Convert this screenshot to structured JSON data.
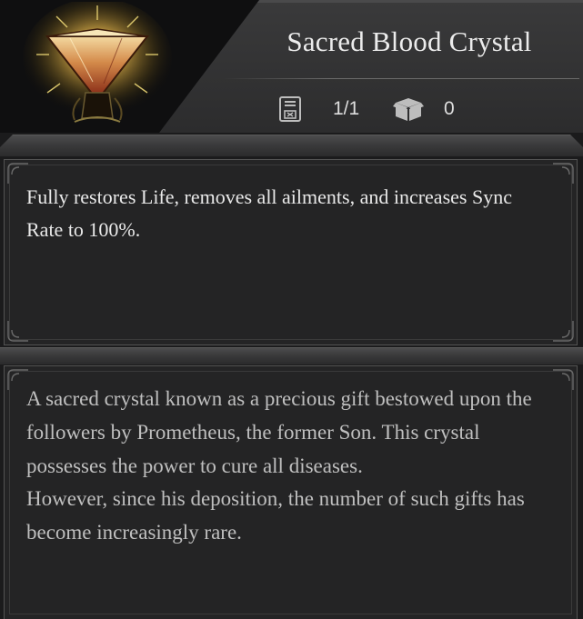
{
  "item": {
    "name": "Sacred Blood Crystal",
    "icon": "sacred-blood-crystal-icon"
  },
  "stats": {
    "carry_icon": "save-slot-icon",
    "carry": "1/1",
    "storage_icon": "storage-box-icon",
    "storage": "0"
  },
  "effect": {
    "text": "Fully restores Life, removes all ailments, and increases Sync Rate to 100%."
  },
  "lore": {
    "paragraph1": "A sacred crystal known as a precious gift bestowed upon the followers by Prometheus, the former Son. This crystal possesses the power to cure all diseases.",
    "paragraph2": "However, since his deposition, the number of such gifts has become increasingly rare."
  },
  "colors": {
    "crystal_gold": "#e8b84a",
    "crystal_red": "#b0472a",
    "text_primary": "#e9e9e9",
    "text_secondary": "#bfbfbf"
  }
}
